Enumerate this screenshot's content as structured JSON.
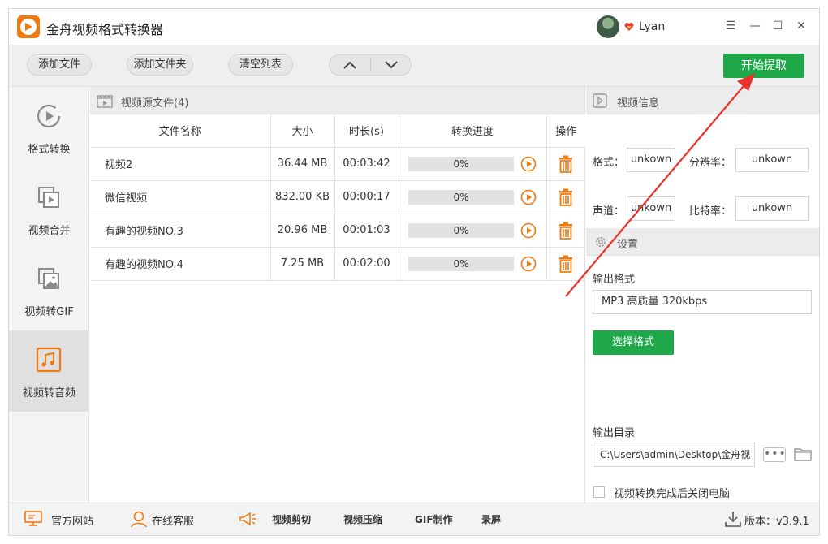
{
  "app": {
    "title": "金舟视频格式转换器",
    "username": "Lyan"
  },
  "window_controls": {
    "menu": "☰",
    "minimize": "—",
    "maximize": "☐",
    "close": "✕"
  },
  "toolbar": {
    "add_file": "添加文件",
    "add_folder": "添加文件夹",
    "clear_list": "清空列表",
    "start_extract": "开始提取"
  },
  "sidebar": {
    "items": [
      {
        "label": "格式转换",
        "icon": "format-convert-icon"
      },
      {
        "label": "视频合并",
        "icon": "video-merge-icon"
      },
      {
        "label": "视频转GIF",
        "icon": "video-to-gif-icon"
      },
      {
        "label": "视频转音频",
        "icon": "video-to-audio-icon",
        "active": true
      }
    ]
  },
  "file_list": {
    "header": "视频源文件(4)",
    "columns": [
      "文件名称",
      "大小",
      "时长(s)",
      "转换进度",
      "操作"
    ],
    "rows": [
      {
        "name": "视频2",
        "size": "36.44 MB",
        "duration": "00:03:42",
        "progress": "0%"
      },
      {
        "name": "微信视频",
        "size": "832.00 KB",
        "duration": "00:00:17",
        "progress": "0%"
      },
      {
        "name": "有趣的视频NO.3",
        "size": "20.96 MB",
        "duration": "00:01:03",
        "progress": "0%"
      },
      {
        "name": "有趣的视频NO.4",
        "size": "7.25 MB",
        "duration": "00:02:00",
        "progress": "0%"
      }
    ]
  },
  "video_info": {
    "header": "视频信息",
    "format_label": "格式：",
    "format_value": "unkown",
    "resolution_label": "分辨率：",
    "resolution_value": "unkown",
    "channel_label": "声道：",
    "channel_value": "unkown",
    "bitrate_label": "比特率：",
    "bitrate_value": "unkown"
  },
  "settings": {
    "header": "设置",
    "output_format_label": "输出格式",
    "output_format_value": "MP3 高质量 320kbps",
    "select_format": "选择格式",
    "output_dir_label": "输出目录",
    "output_dir_value": "C:\\Users\\admin\\Desktop\\金舟视",
    "dots": "•••",
    "shutdown_label": "视频转换完成后关闭电脑"
  },
  "footer": {
    "website": "官方网站",
    "support": "在线客服",
    "clip": "视频剪切",
    "compress": "视频压缩",
    "gif": "GIF制作",
    "record": "录屏",
    "version": "版本：v3.9.1"
  },
  "colors": {
    "accent_green": "#1ea84a",
    "accent_orange": "#f07a10",
    "annotation_red": "#e8322a"
  }
}
